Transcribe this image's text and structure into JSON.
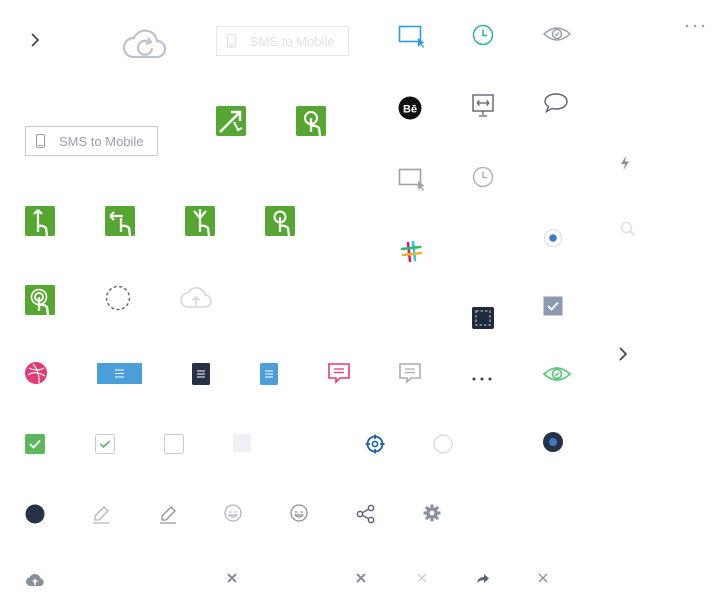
{
  "sms_to_mobile": {
    "label": "SMS to Mobile"
  },
  "colors": {
    "green": "#56a632",
    "blue": "#2d9fe0",
    "dark": "#263245",
    "pink": "#e03a79",
    "gray": "#9aa0a8",
    "light_gray": "#c9ccd1",
    "teal": "#2bb3a8",
    "check_green": "#5cb85c",
    "eye_green": "#5cc87a",
    "crosshair_blue": "#1a5fa8"
  },
  "icons": [
    "chevron-right-icon",
    "cloud-sync-icon",
    "sms-to-mobile-button",
    "select-area-icon",
    "clock-icon",
    "eye-icon",
    "more-horizontal-icon",
    "behance-icon",
    "screen-width-icon",
    "chat-bubble-icon",
    "flash-icon",
    "search-icon",
    "slack-icon",
    "radio-selected-icon",
    "checkbox-checked-icon",
    "dribbble-icon",
    "document-icon",
    "comment-icon",
    "crosshair-icon",
    "gear-icon",
    "share-icon",
    "pencil-icon",
    "smiley-icon",
    "close-icon",
    "forward-icon",
    "cloud-upload-icon"
  ]
}
